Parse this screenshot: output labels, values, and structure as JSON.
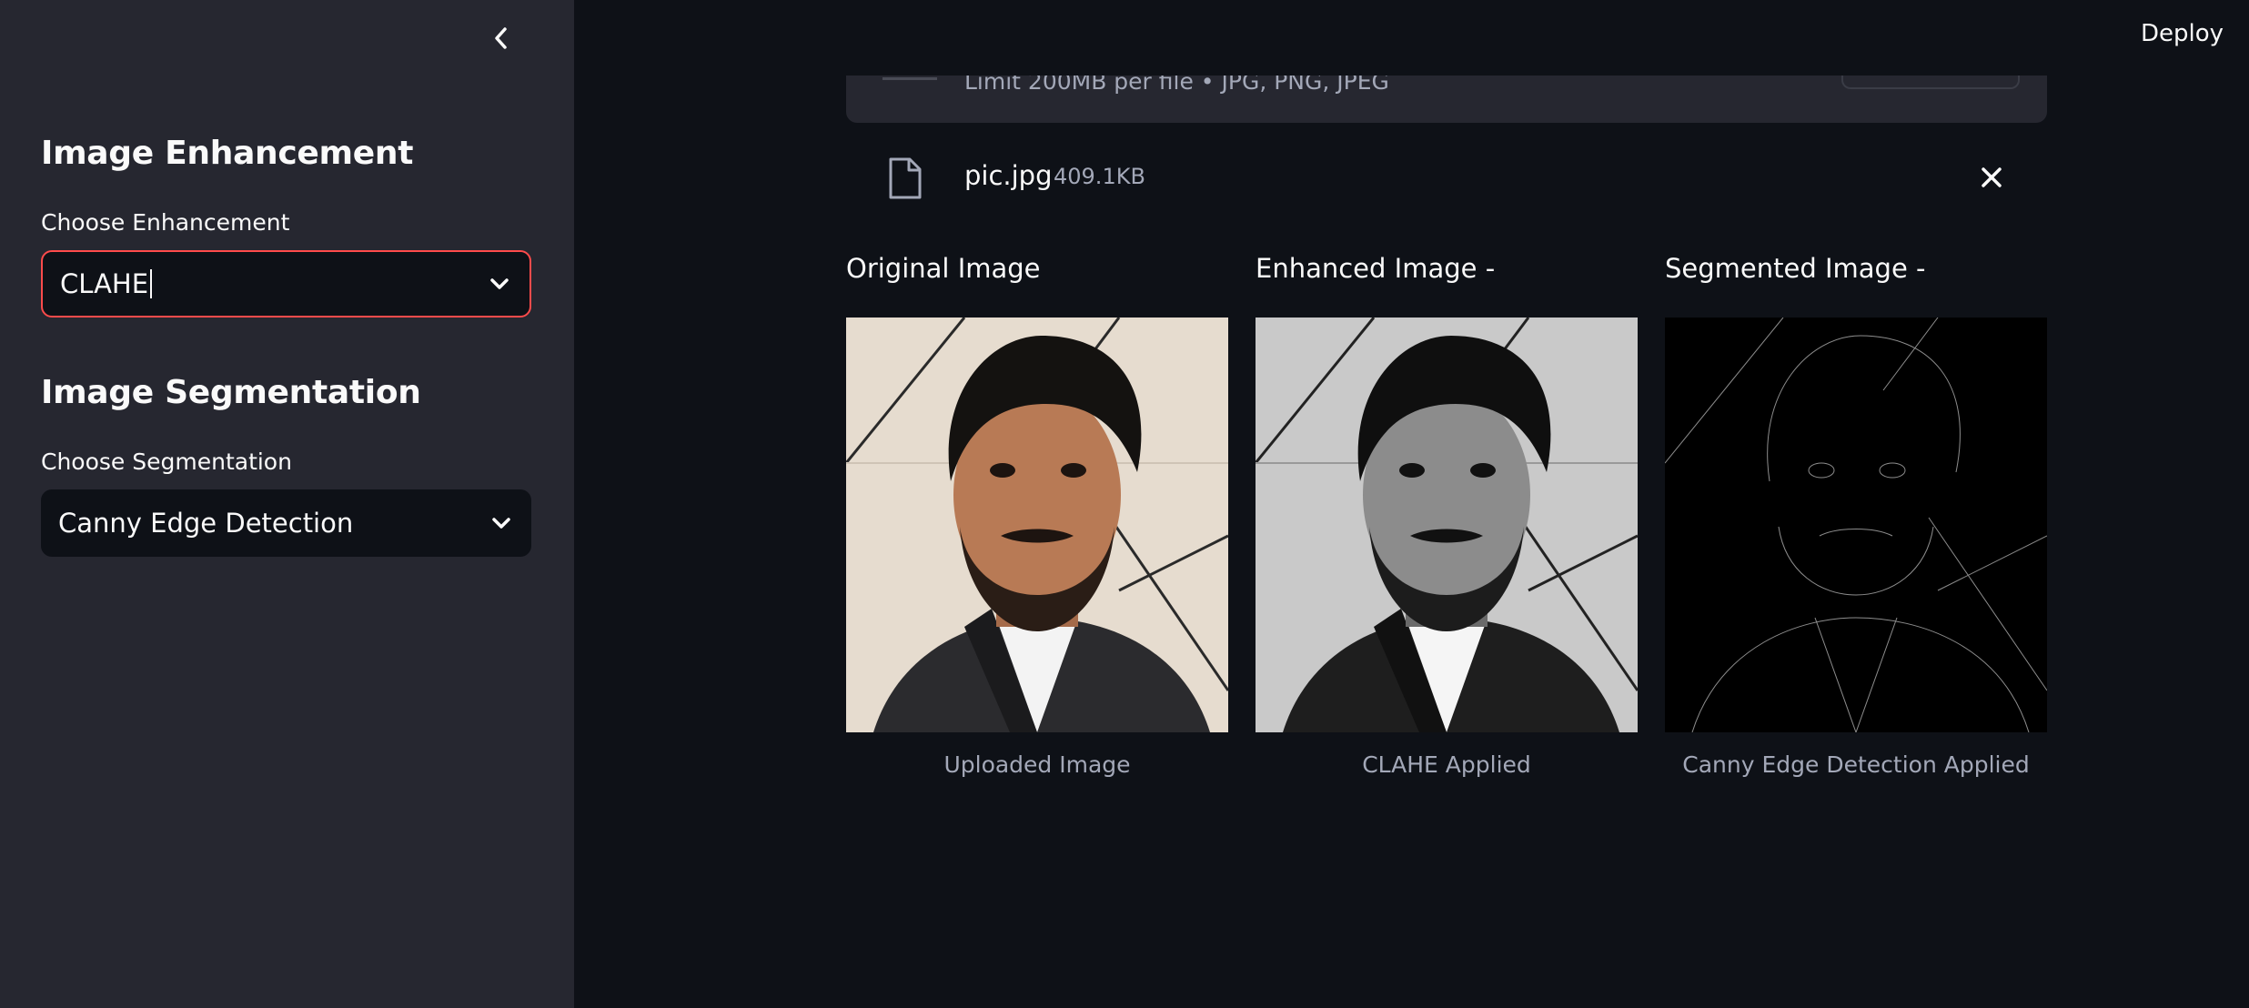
{
  "header": {
    "deploy_label": "Deploy"
  },
  "sidebar": {
    "enhancement": {
      "heading": "Image Enhancement",
      "label": "Choose Enhancement",
      "value": "CLAHE"
    },
    "segmentation": {
      "heading": "Image Segmentation",
      "label": "Choose Segmentation",
      "value": "Canny Edge Detection"
    }
  },
  "uploader": {
    "limit_text": "Limit 200MB per file • JPG, PNG, JPEG",
    "file": {
      "name": "pic.jpg",
      "size": "409.1KB"
    }
  },
  "columns": [
    {
      "title": "Original Image",
      "caption": "Uploaded Image"
    },
    {
      "title": "Enhanced Image -",
      "caption": "CLAHE Applied"
    },
    {
      "title": "Segmented Image -",
      "caption": "Canny Edge Detection Applied"
    }
  ],
  "colors": {
    "background": "#0e1117",
    "sidebar": "#262730",
    "accent_focus": "#ff4b4b",
    "muted_text": "#a3a8b8"
  }
}
